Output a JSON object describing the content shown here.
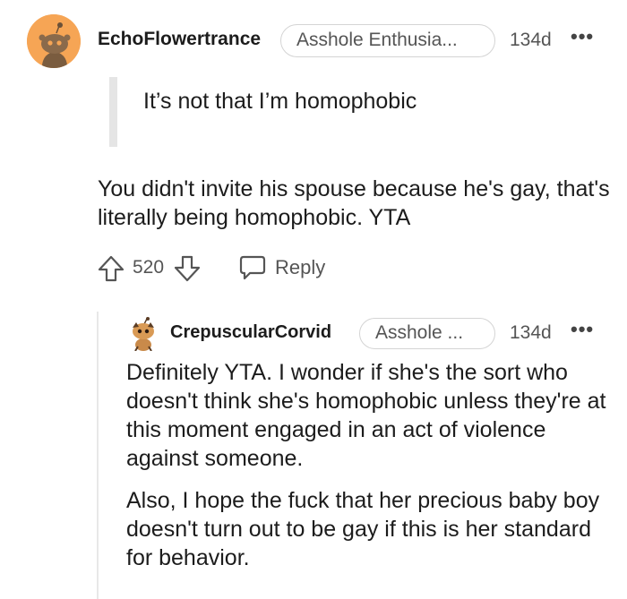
{
  "comment": {
    "username": "EchoFlowertrance",
    "flair": "Asshole Enthusia...",
    "age": "134d",
    "more_label": "•••",
    "quote": "It’s not that I’m homophobic",
    "body": "You didn't invite his spouse because he's gay, that's literally being homophobic. YTA",
    "score": "520",
    "reply_label": "Reply"
  },
  "reply": {
    "username": "CrepuscularCorvid",
    "flair": "Asshole ...",
    "age": "134d",
    "more_label": "•••",
    "paragraphs": [
      "Definitely YTA. I wonder if she's the sort who doesn't think she's homophobic unless they're at this moment engaged in an act of violence against someone.",
      "Also, I hope the fuck that her precious baby boy doesn't turn out to be gay if this is her standard for behavior."
    ]
  }
}
